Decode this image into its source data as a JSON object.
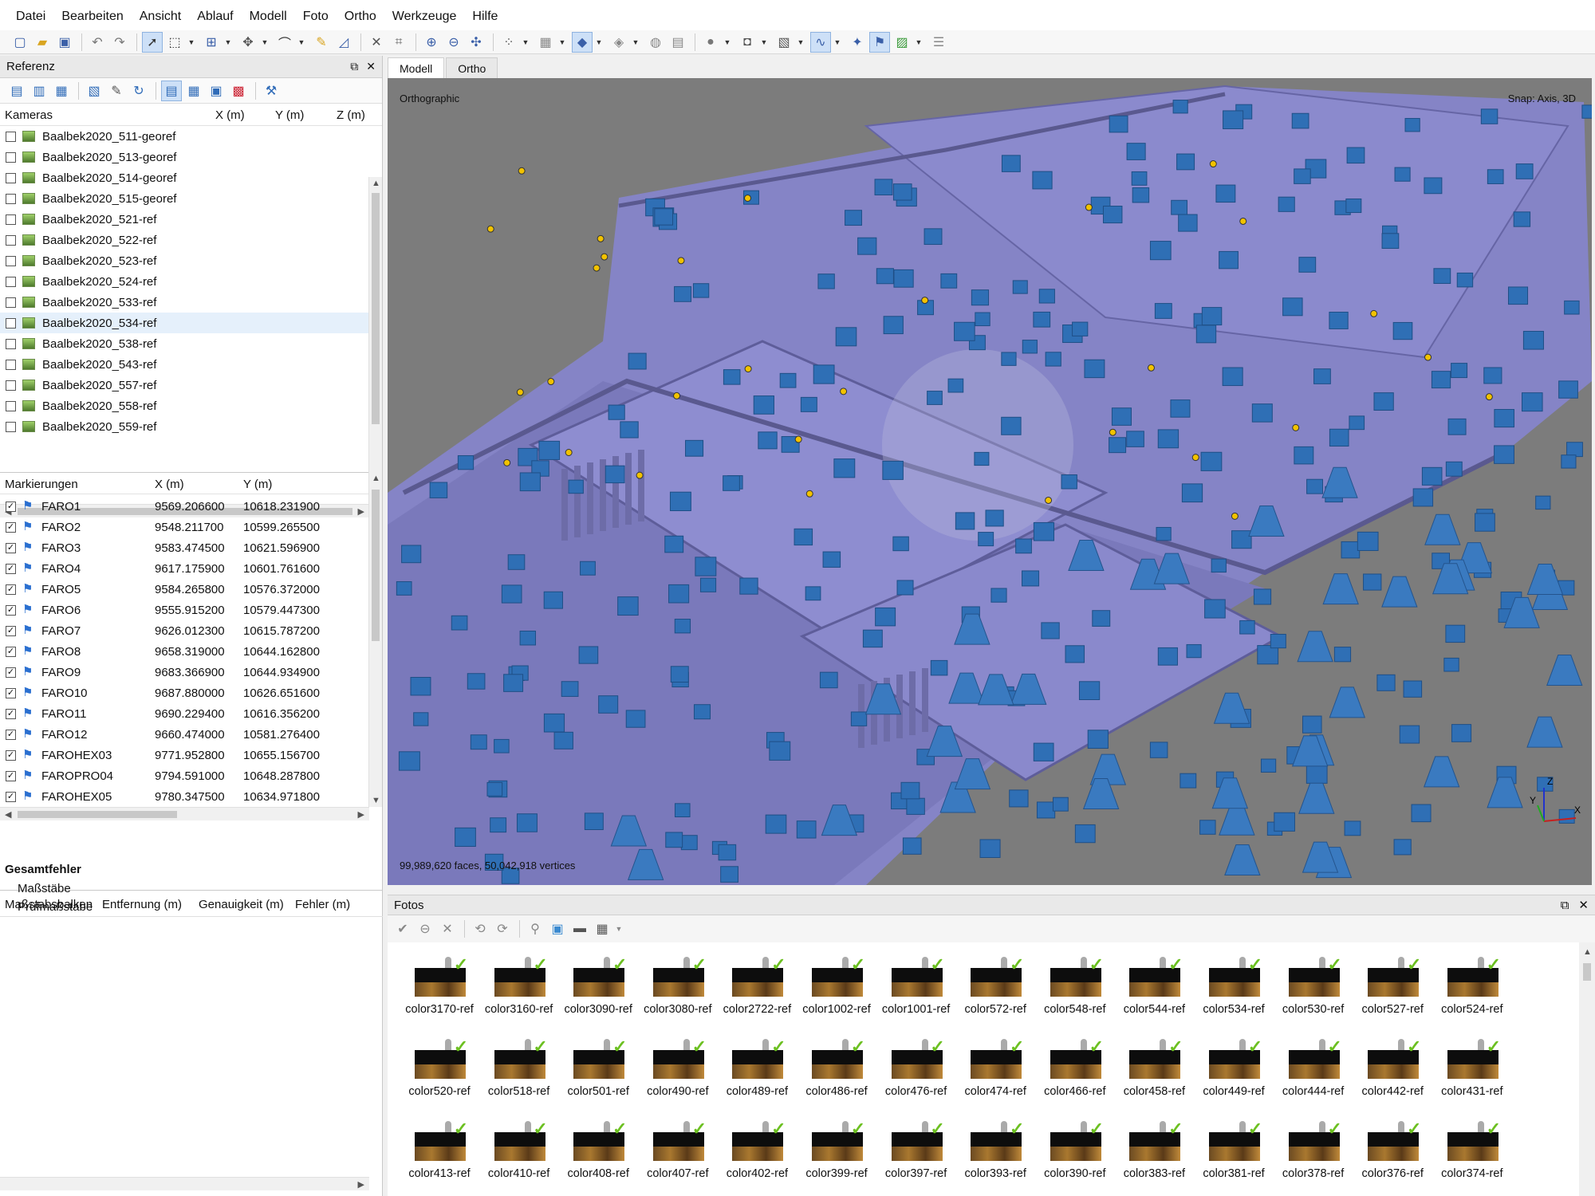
{
  "menu": [
    "Datei",
    "Bearbeiten",
    "Ansicht",
    "Ablauf",
    "Modell",
    "Foto",
    "Ortho",
    "Werkzeuge",
    "Hilfe"
  ],
  "reference_panel": {
    "title": "Referenz",
    "cameras": {
      "headers": {
        "name": "Kameras",
        "x": "X (m)",
        "y": "Y (m)",
        "z": "Z (m)"
      },
      "items": [
        "Baalbek2020_511-georef",
        "Baalbek2020_513-georef",
        "Baalbek2020_514-georef",
        "Baalbek2020_515-georef",
        "Baalbek2020_521-ref",
        "Baalbek2020_522-ref",
        "Baalbek2020_523-ref",
        "Baalbek2020_524-ref",
        "Baalbek2020_533-ref",
        "Baalbek2020_534-ref",
        "Baalbek2020_538-ref",
        "Baalbek2020_543-ref",
        "Baalbek2020_557-ref",
        "Baalbek2020_558-ref",
        "Baalbek2020_559-ref"
      ],
      "selected_index": 9
    },
    "markers": {
      "headers": {
        "name": "Markierungen",
        "x": "X (m)",
        "y": "Y (m)"
      },
      "items": [
        {
          "name": "FARO1",
          "x": "9569.206600",
          "y": "10618.231900"
        },
        {
          "name": "FARO2",
          "x": "9548.211700",
          "y": "10599.265500"
        },
        {
          "name": "FARO3",
          "x": "9583.474500",
          "y": "10621.596900"
        },
        {
          "name": "FARO4",
          "x": "9617.175900",
          "y": "10601.761600"
        },
        {
          "name": "FARO5",
          "x": "9584.265800",
          "y": "10576.372000"
        },
        {
          "name": "FARO6",
          "x": "9555.915200",
          "y": "10579.447300"
        },
        {
          "name": "FARO7",
          "x": "9626.012300",
          "y": "10615.787200"
        },
        {
          "name": "FARO8",
          "x": "9658.319000",
          "y": "10644.162800"
        },
        {
          "name": "FARO9",
          "x": "9683.366900",
          "y": "10644.934900"
        },
        {
          "name": "FARO10",
          "x": "9687.880000",
          "y": "10626.651600"
        },
        {
          "name": "FARO11",
          "x": "9690.229400",
          "y": "10616.356200"
        },
        {
          "name": "FARO12",
          "x": "9660.474000",
          "y": "10581.276400"
        },
        {
          "name": "FAROHEX03",
          "x": "9771.952800",
          "y": "10655.156700"
        },
        {
          "name": "FAROPRO04",
          "x": "9794.591000",
          "y": "10648.287800"
        },
        {
          "name": "FAROHEX05",
          "x": "9780.347500",
          "y": "10634.971800"
        }
      ]
    },
    "scalebars": {
      "headers": {
        "name": "Maßstabsbalken",
        "dist": "Entfernung (m)",
        "acc": "Genauigkeit (m)",
        "err": "Fehler (m)"
      },
      "total_label": "Gesamtfehler",
      "children": [
        "Maßstäbe",
        "Prüfmaßstäbe"
      ]
    }
  },
  "view_tabs": [
    "Modell",
    "Ortho"
  ],
  "viewport": {
    "projection_label": "Orthographic",
    "snap_label": "Snap: Axis, 3D",
    "stats_label": "99,989,620 faces, 50,042,918 vertices",
    "axis": {
      "x": "X",
      "y": "Y",
      "z": "Z"
    }
  },
  "photos_panel": {
    "title": "Fotos",
    "rows": [
      [
        "color3170-ref",
        "color3160-ref",
        "color3090-ref",
        "color3080-ref",
        "color2722-ref",
        "color1002-ref",
        "color1001-ref",
        "color572-ref",
        "color548-ref",
        "color544-ref",
        "color534-ref",
        "color530-ref",
        "color527-ref",
        "color524-ref"
      ],
      [
        "color520-ref",
        "color518-ref",
        "color501-ref",
        "color490-ref",
        "color489-ref",
        "color486-ref",
        "color476-ref",
        "color474-ref",
        "color466-ref",
        "color458-ref",
        "color449-ref",
        "color444-ref",
        "color442-ref",
        "color431-ref"
      ],
      [
        "color413-ref",
        "color410-ref",
        "color408-ref",
        "color407-ref",
        "color402-ref",
        "color399-ref",
        "color397-ref",
        "color393-ref",
        "color390-ref",
        "color383-ref",
        "color381-ref",
        "color378-ref",
        "color376-ref",
        "color374-ref"
      ]
    ]
  },
  "colors": {
    "model": "#8584c6",
    "camera": "#2f6fb5",
    "marker": "#f2c200",
    "background": "#7c7c7c"
  }
}
